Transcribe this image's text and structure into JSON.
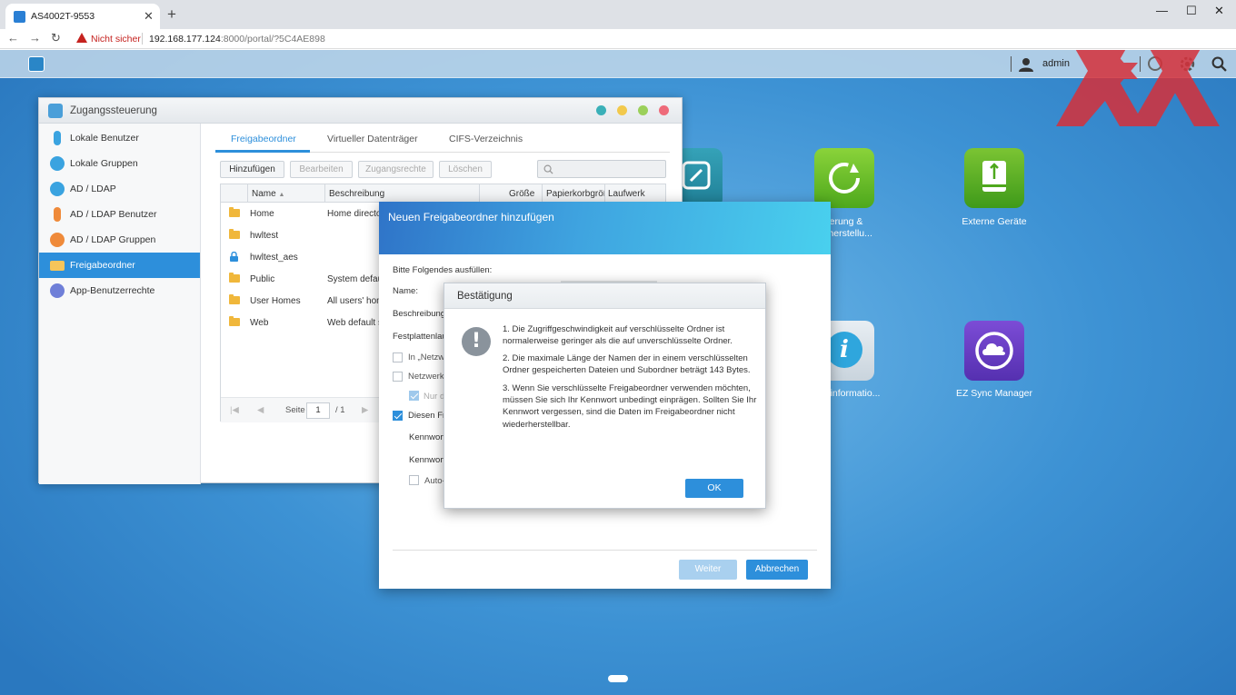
{
  "browser": {
    "tab_title": "AS4002T-9553",
    "tab_close": "✕",
    "new_tab": "+",
    "minimize": "—",
    "maximize": "☐",
    "close": "✕",
    "back": "←",
    "forward": "→",
    "reload": "↻",
    "security_warning": "Nicht sicher",
    "url_host": "192.168.177.124",
    "url_path": ":8000/portal/?5C4AE898"
  },
  "nas_topbar": {
    "user": "admin"
  },
  "desktop_apps": [
    {
      "label": "erung &\nerherstellu..."
    },
    {
      "label": "Externe Geräte"
    },
    {
      "label": "informatio..."
    },
    {
      "label": "EZ Sync Manager"
    }
  ],
  "access_window": {
    "title": "Zugangssteuerung",
    "sidebar": [
      {
        "label": "Lokale Benutzer"
      },
      {
        "label": "Lokale Gruppen"
      },
      {
        "label": "AD / LDAP"
      },
      {
        "label": "AD / LDAP Benutzer"
      },
      {
        "label": "AD / LDAP Gruppen"
      },
      {
        "label": "Freigabeordner"
      },
      {
        "label": "App-Benutzerrechte"
      }
    ],
    "tabs": [
      {
        "label": "Freigabeordner"
      },
      {
        "label": "Virtueller Datenträger"
      },
      {
        "label": "CIFS-Verzeichnis"
      }
    ],
    "toolbar": {
      "add": "Hinzufügen",
      "edit": "Bearbeiten",
      "access": "Zugangsrechte",
      "delete": "Löschen"
    },
    "columns": {
      "name": "Name",
      "sort": "▲",
      "description": "Beschreibung",
      "size": "Größe",
      "recycle": "Papierkorbgröß",
      "volume": "Laufwerk"
    },
    "rows": [
      {
        "name": "Home",
        "description": "Home director"
      },
      {
        "name": "hwltest",
        "description": ""
      },
      {
        "name": "hwltest_aes",
        "description": ""
      },
      {
        "name": "Public",
        "description": "System default"
      },
      {
        "name": "User Homes",
        "description": "All users' home"
      },
      {
        "name": "Web",
        "description": "Web default sh"
      }
    ],
    "pager": {
      "first": "|◀",
      "prev": "◀",
      "page_label": "Seite",
      "page": "1",
      "of": "/ 1",
      "next": "▶"
    }
  },
  "wizard": {
    "title": "Neuen Freigabeordner hinzufügen",
    "intro": "Bitte Folgendes ausfüllen:",
    "name_label": "Name:",
    "desc_label": "Beschreibung:",
    "volume_label": "Festplattenlau",
    "opt_network1": "In „Netzw",
    "opt_network2": "Netzwerk",
    "opt_readonly": "Nur d",
    "opt_encrypt": "Diesen Fre",
    "password_label": "Kennwort",
    "password_confirm_label": "Kennwort",
    "opt_auto": "Auto-",
    "next": "Weiter",
    "cancel": "Abbrechen"
  },
  "confirm": {
    "title": "Bestätigung",
    "alert_symbol": "!",
    "messages": [
      "1. Die Zugriffgeschwindigkeit auf verschlüsselte Ordner ist normalerweise geringer als die auf unverschlüsselte Ordner.",
      "2. Die maximale Länge der Namen der in einem verschlüsselten Ordner gespeicherten Dateien und Subordner beträgt 143 Bytes.",
      "3. Wenn Sie verschlüsselte Freigabeordner verwenden möchten, müssen Sie sich Ihr Kennwort unbedingt einprägen. Sollten Sie Ihr Kennwort vergessen, sind die Daten im Freigabeordner nicht wiederherstellbar."
    ],
    "ok": "OK"
  },
  "colors": {
    "accent": "#2d8fdb",
    "warning": "#c5221f",
    "folder": "#f0b73b",
    "watermark": "#d6303a"
  }
}
